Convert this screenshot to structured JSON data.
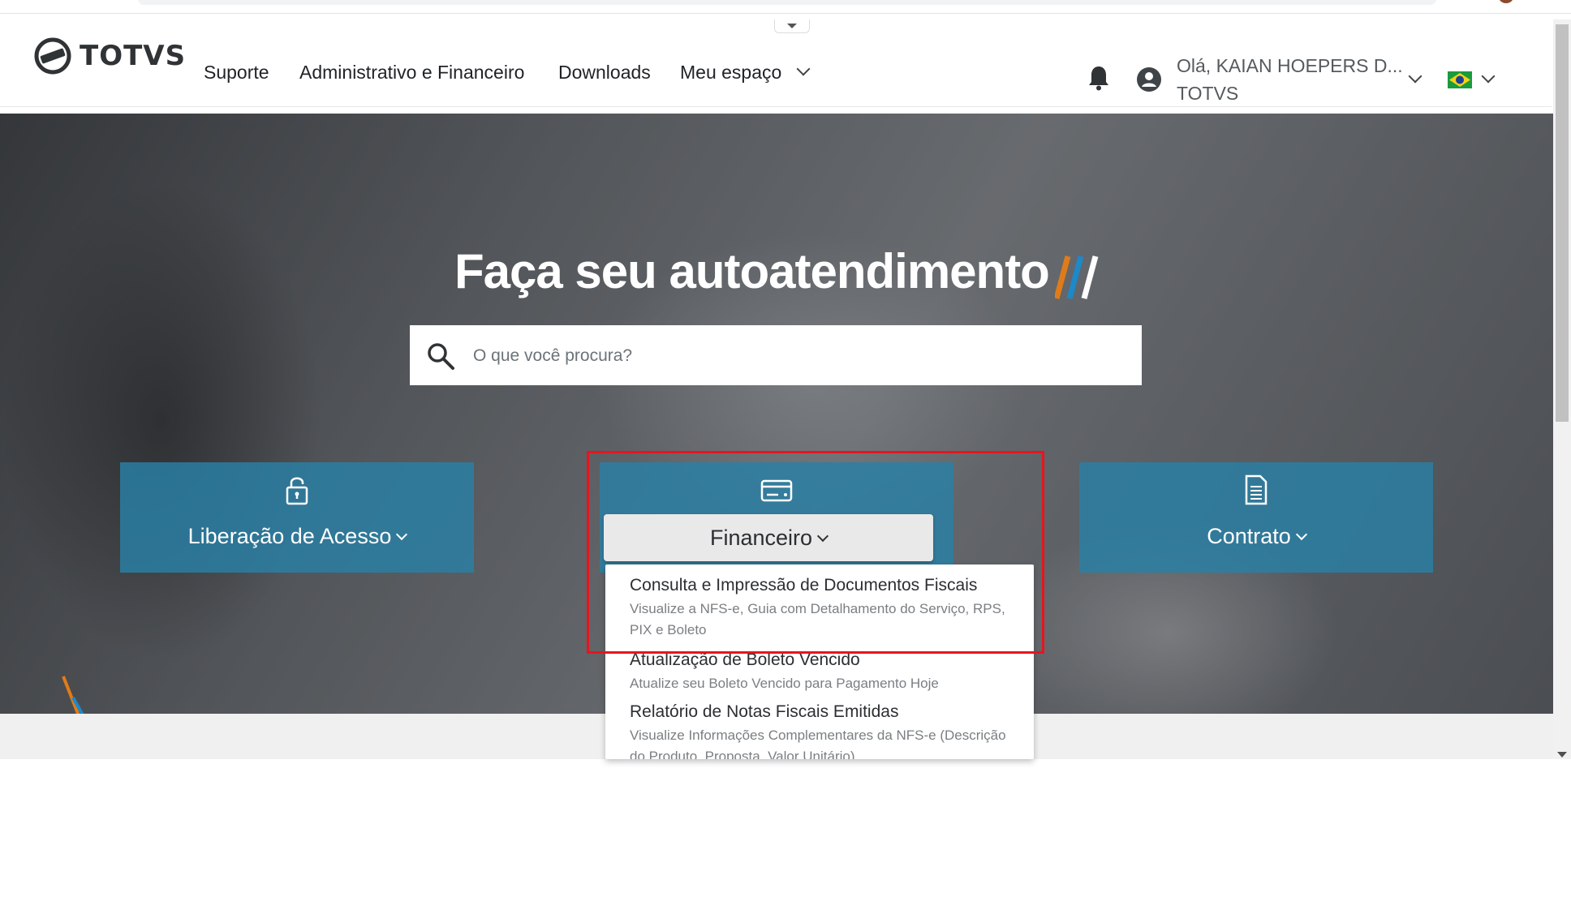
{
  "header": {
    "logo_text": "TOTVS",
    "nav": [
      "Suporte",
      "Administrativo e Financeiro",
      "Downloads",
      "Meu espaço"
    ],
    "user_name": "Olá, KAIAN HOEPERS D...",
    "user_org": "TOTVS"
  },
  "hero": {
    "title": "Faça seu autoatendimento",
    "search_placeholder": "O que você procura?"
  },
  "cards": {
    "acesso": "Liberação de Acesso",
    "financeiro": "Financeiro",
    "contrato": "Contrato"
  },
  "dropdown": {
    "items": [
      {
        "title": "Consulta e Impressão de Documentos Fiscais",
        "desc": "Visualize a NFS-e, Guia com Detalhamento do Serviço, RPS, PIX e Boleto"
      },
      {
        "title": "Atualização de Boleto Vencido",
        "desc": "Atualize seu Boleto Vencido para Pagamento Hoje"
      },
      {
        "title": "Relatório de Notas Fiscais Emitidas",
        "desc": "Visualize Informações Complementares da NFS-e (Descrição do Produto, Proposta, Valor Unitário)"
      }
    ]
  },
  "colors": {
    "card_blue": "#2980a6",
    "highlight_red": "#e8141e",
    "accent_orange": "#e07b1a",
    "accent_blue": "#1e88c8"
  }
}
